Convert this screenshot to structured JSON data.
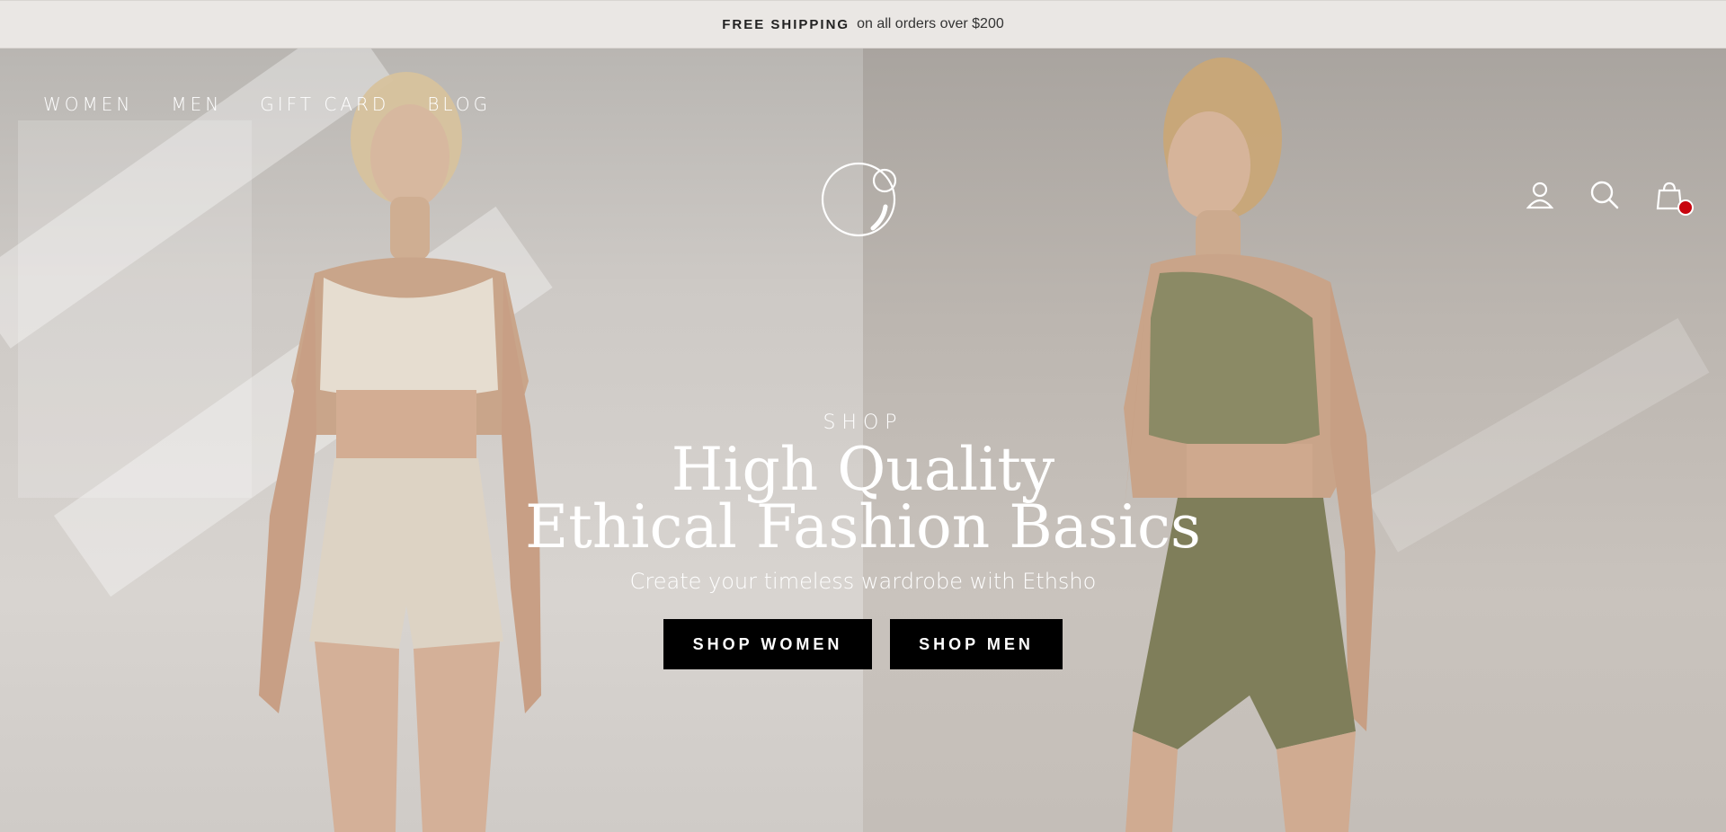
{
  "announcement": {
    "strong": "FREE SHIPPING",
    "text": "on all orders over $200"
  },
  "nav": {
    "links": [
      "WOMEN",
      "MEN",
      "GIFT CARD",
      "BLOG"
    ]
  },
  "header_icons": {
    "account": "user-icon",
    "search": "search-icon",
    "cart": "shopping-bag-icon",
    "cart_badge_color": "#c8040e"
  },
  "hero": {
    "eyebrow": "SHOP",
    "title_line1": "High Quality",
    "title_line2": "Ethical Fashion Basics",
    "subtitle": "Create your timeless wardrobe with Ethsho",
    "cta_women": "SHOP WOMEN",
    "cta_men": "SHOP MEN"
  },
  "colors": {
    "accent": "#000000",
    "announcement_bg": "#eae7e4",
    "hero_text": "#ffffff"
  }
}
